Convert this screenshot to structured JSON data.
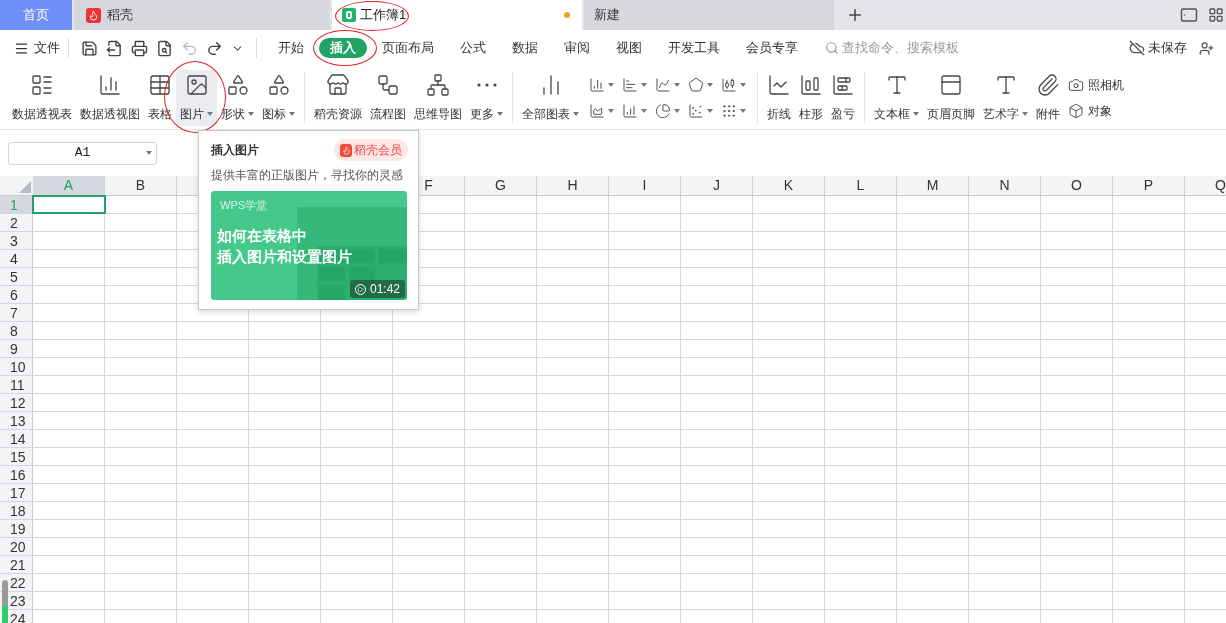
{
  "tabs": [
    {
      "label": "首页",
      "kind": "home",
      "selected": false,
      "circled": false
    },
    {
      "label": "稻壳",
      "kind": "docer",
      "selected": false,
      "circled": false
    },
    {
      "label": "工作簿1",
      "kind": "sheet",
      "selected": true,
      "circled": true,
      "unsaved": true
    },
    {
      "label": "新建",
      "kind": "new",
      "selected": false,
      "circled": false
    }
  ],
  "menu": {
    "file": "文件",
    "quick_access": [
      {
        "disabled": false
      },
      {
        "disabled": false
      },
      {
        "disabled": false
      },
      {
        "disabled": false
      },
      {
        "disabled": true
      },
      {
        "disabled": false
      }
    ],
    "tabs": [
      {
        "label": "开始",
        "selected": false,
        "circled": false
      },
      {
        "label": "插入",
        "selected": true,
        "circled": true
      },
      {
        "label": "页面布局",
        "selected": false,
        "circled": false
      },
      {
        "label": "公式",
        "selected": false,
        "circled": false
      },
      {
        "label": "数据",
        "selected": false,
        "circled": false
      },
      {
        "label": "审阅",
        "selected": false,
        "circled": false
      },
      {
        "label": "视图",
        "selected": false,
        "circled": false
      },
      {
        "label": "开发工具",
        "selected": false,
        "circled": false
      },
      {
        "label": "会员专享",
        "selected": false,
        "circled": false
      }
    ],
    "search_placeholder": "查找命令、搜索模板",
    "save_status": "未保存"
  },
  "ribbon": [
    {
      "items": [
        {
          "kind": "large",
          "label": "数据透视表",
          "dropdown": false,
          "selected": false,
          "circled": false
        },
        {
          "kind": "large",
          "label": "数据透视图",
          "dropdown": false,
          "selected": false,
          "circled": false
        },
        {
          "kind": "large",
          "label": "表格",
          "dropdown": false,
          "selected": false,
          "circled": false
        },
        {
          "kind": "large",
          "label": "图片",
          "dropdown": true,
          "selected": true,
          "circled": true
        },
        {
          "kind": "large",
          "label": "形状",
          "dropdown": true,
          "selected": false,
          "circled": false
        },
        {
          "kind": "large",
          "label": "图标",
          "dropdown": true,
          "selected": false,
          "circled": false
        }
      ]
    },
    {
      "items": [
        {
          "kind": "large",
          "label": "稻壳资源",
          "dropdown": false,
          "selected": false,
          "circled": false
        },
        {
          "kind": "large",
          "label": "流程图",
          "dropdown": false,
          "selected": false,
          "circled": false
        },
        {
          "kind": "large",
          "label": "思维导图",
          "dropdown": false,
          "selected": false,
          "circled": false
        },
        {
          "kind": "large",
          "label": "更多",
          "dropdown": true,
          "selected": false,
          "circled": false
        }
      ]
    },
    {
      "items": [
        {
          "kind": "large",
          "label": "全部图表",
          "dropdown": true,
          "selected": false,
          "circled": false
        },
        {
          "kind": "chart_grid"
        }
      ]
    },
    {
      "items": [
        {
          "kind": "large",
          "label": "折线",
          "dropdown": false,
          "selected": false,
          "circled": false
        },
        {
          "kind": "large",
          "label": "柱形",
          "dropdown": false,
          "selected": false,
          "circled": false
        },
        {
          "kind": "large",
          "label": "盈亏",
          "dropdown": false,
          "selected": false,
          "circled": false
        }
      ]
    },
    {
      "items": [
        {
          "kind": "large",
          "label": "文本框",
          "dropdown": true,
          "selected": false,
          "circled": false
        },
        {
          "kind": "large",
          "label": "页眉页脚",
          "dropdown": false,
          "selected": false,
          "circled": false
        },
        {
          "kind": "large",
          "label": "艺术字",
          "dropdown": true,
          "selected": false,
          "circled": false
        },
        {
          "kind": "large",
          "label": "附件",
          "dropdown": false,
          "selected": false,
          "circled": false
        },
        {
          "kind": "small",
          "labels": [
            "照相机",
            "对象"
          ]
        }
      ]
    }
  ],
  "name_box": "A1",
  "sheet": {
    "columns_left": [
      {
        "label": "A",
        "selected": true
      },
      {
        "label": "B",
        "selected": false
      }
    ],
    "columns_right": [
      {
        "label": "F",
        "selected": false
      },
      {
        "label": "G",
        "selected": false
      },
      {
        "label": "H",
        "selected": false
      },
      {
        "label": "I",
        "selected": false
      },
      {
        "label": "J",
        "selected": false
      },
      {
        "label": "K",
        "selected": false
      },
      {
        "label": "L",
        "selected": false
      },
      {
        "label": "M",
        "selected": false
      },
      {
        "label": "N",
        "selected": false
      },
      {
        "label": "O",
        "selected": false
      },
      {
        "label": "P",
        "selected": false
      },
      {
        "label": "Q",
        "selected": false
      }
    ],
    "rows": [
      {
        "label": "1",
        "selected": true
      },
      {
        "label": "2",
        "selected": false
      },
      {
        "label": "3",
        "selected": false
      },
      {
        "label": "4",
        "selected": false
      },
      {
        "label": "5",
        "selected": false
      },
      {
        "label": "6",
        "selected": false
      },
      {
        "label": "7",
        "selected": false
      },
      {
        "label": "8",
        "selected": false
      },
      {
        "label": "9",
        "selected": false
      },
      {
        "label": "10",
        "selected": false
      },
      {
        "label": "11",
        "selected": false
      },
      {
        "label": "12",
        "selected": false
      },
      {
        "label": "13",
        "selected": false
      },
      {
        "label": "14",
        "selected": false
      },
      {
        "label": "15",
        "selected": false
      },
      {
        "label": "16",
        "selected": false
      },
      {
        "label": "17",
        "selected": false
      },
      {
        "label": "18",
        "selected": false
      },
      {
        "label": "19",
        "selected": false
      },
      {
        "label": "20",
        "selected": false
      },
      {
        "label": "21",
        "selected": false
      },
      {
        "label": "22",
        "selected": false
      },
      {
        "label": "23",
        "selected": false
      },
      {
        "label": "24",
        "selected": false
      }
    ]
  },
  "popup": {
    "title": "插入图片",
    "badge": "稻壳会员",
    "description": "提供丰富的正版图片，寻找你的灵感",
    "video": {
      "brand": "WPS学堂",
      "title_lines": [
        "如何在表格中",
        "插入图片和设置图片"
      ],
      "duration": "01:42"
    }
  }
}
